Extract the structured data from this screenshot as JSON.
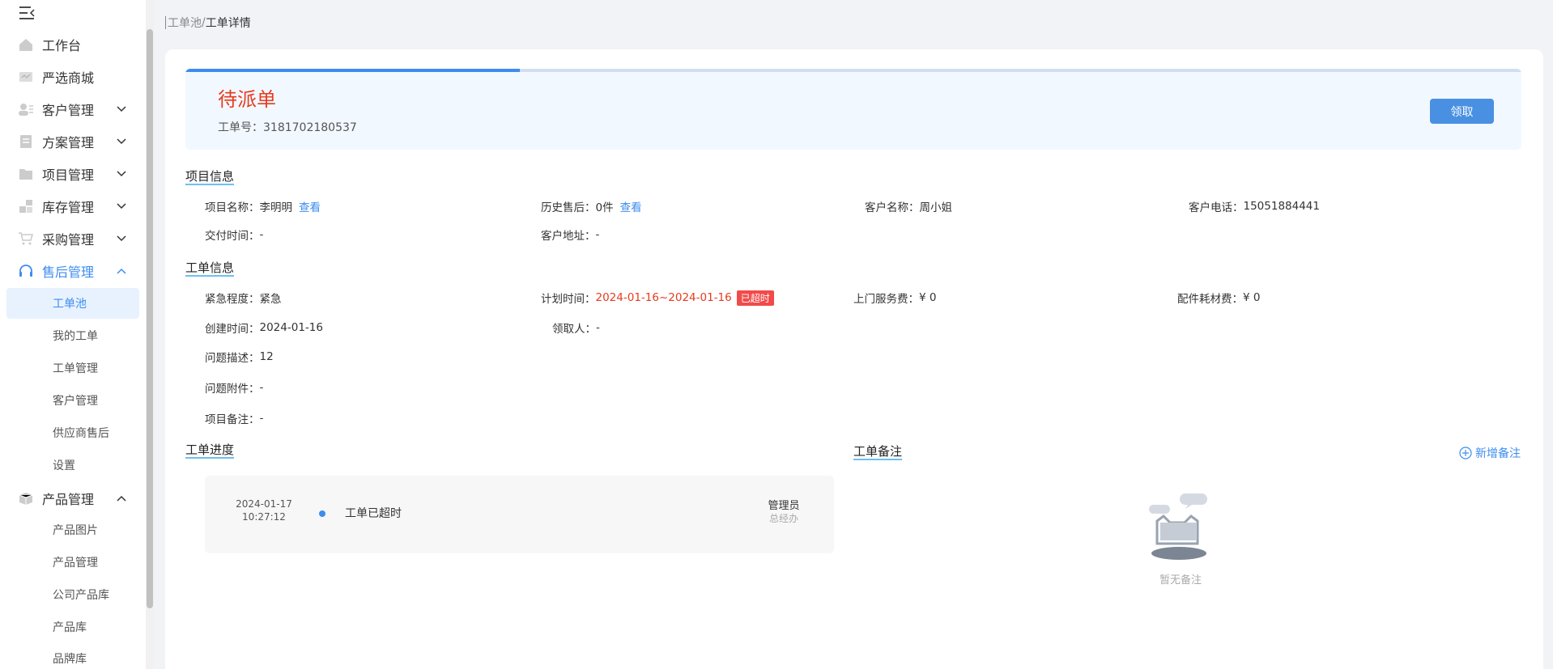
{
  "sidebar": {
    "menu": [
      {
        "label": "工作台",
        "expand": ""
      },
      {
        "label": "严选商城",
        "expand": ""
      },
      {
        "label": "客户管理",
        "expand": "down"
      },
      {
        "label": "方案管理",
        "expand": "down"
      },
      {
        "label": "项目管理",
        "expand": "down"
      },
      {
        "label": "库存管理",
        "expand": "down"
      },
      {
        "label": "采购管理",
        "expand": "down"
      },
      {
        "label": "售后管理",
        "expand": "up"
      }
    ],
    "after_sales_sub": [
      "工单池",
      "我的工单",
      "工单管理",
      "客户管理",
      "供应商售后",
      "设置"
    ],
    "product_menu": {
      "label": "产品管理",
      "expand": "up"
    },
    "product_sub": [
      "产品图片",
      "产品管理",
      "公司产品库",
      "产品库",
      "品牌库"
    ],
    "accent_color": "#3d8cf0"
  },
  "breadcrumb": {
    "parent": "工单池",
    "separator": "/",
    "current": "工单详情"
  },
  "status": {
    "title": "待派单",
    "order_no_label": "工单号：",
    "order_no": "3181702180537",
    "progress": 0.25,
    "claim_button": "领取",
    "title_color": "#e83a1e"
  },
  "project_info": {
    "title": "项目信息",
    "project_name": {
      "label": "项目名称：",
      "value": "李明明",
      "link": "查看"
    },
    "history": {
      "label": "历史售后：",
      "value": "0件",
      "link": "查看"
    },
    "customer_name": {
      "label": "客户名称：",
      "value": "周小姐"
    },
    "customer_phone": {
      "label": "客户电话：",
      "value": "15051884441"
    },
    "delivery_time": {
      "label": "交付时间：",
      "value": "-"
    },
    "customer_address": {
      "label": "客户地址：",
      "value": "-"
    }
  },
  "order_info": {
    "title": "工单信息",
    "urgency": {
      "label": "紧急程度：",
      "value": "紧急"
    },
    "plan_time": {
      "label": "计划时间：",
      "value": "2024-01-16~2024-01-16",
      "badge": "已超时"
    },
    "visit_fee": {
      "label": "上门服务费：",
      "value": "¥ 0"
    },
    "parts_fee": {
      "label": "配件耗材费：",
      "value": "¥ 0"
    },
    "created": {
      "label": "创建时间：",
      "value": "2024-01-16"
    },
    "receiver": {
      "label": "领取人：",
      "value": "-"
    },
    "problem": {
      "label": "问题描述：",
      "value": "12"
    },
    "attachment": {
      "label": "问题附件：",
      "value": "-"
    },
    "remark": {
      "label": "项目备注：",
      "value": "-"
    }
  },
  "progress_log": {
    "title": "工单进度",
    "entries": [
      {
        "date": "2024-01-17",
        "time": "10:27:12",
        "text": "工单已超时",
        "user": "管理员",
        "role": "总经办"
      }
    ]
  },
  "notes": {
    "title": "工单备注",
    "add_label": "新增备注",
    "empty_text": "暂无备注"
  }
}
